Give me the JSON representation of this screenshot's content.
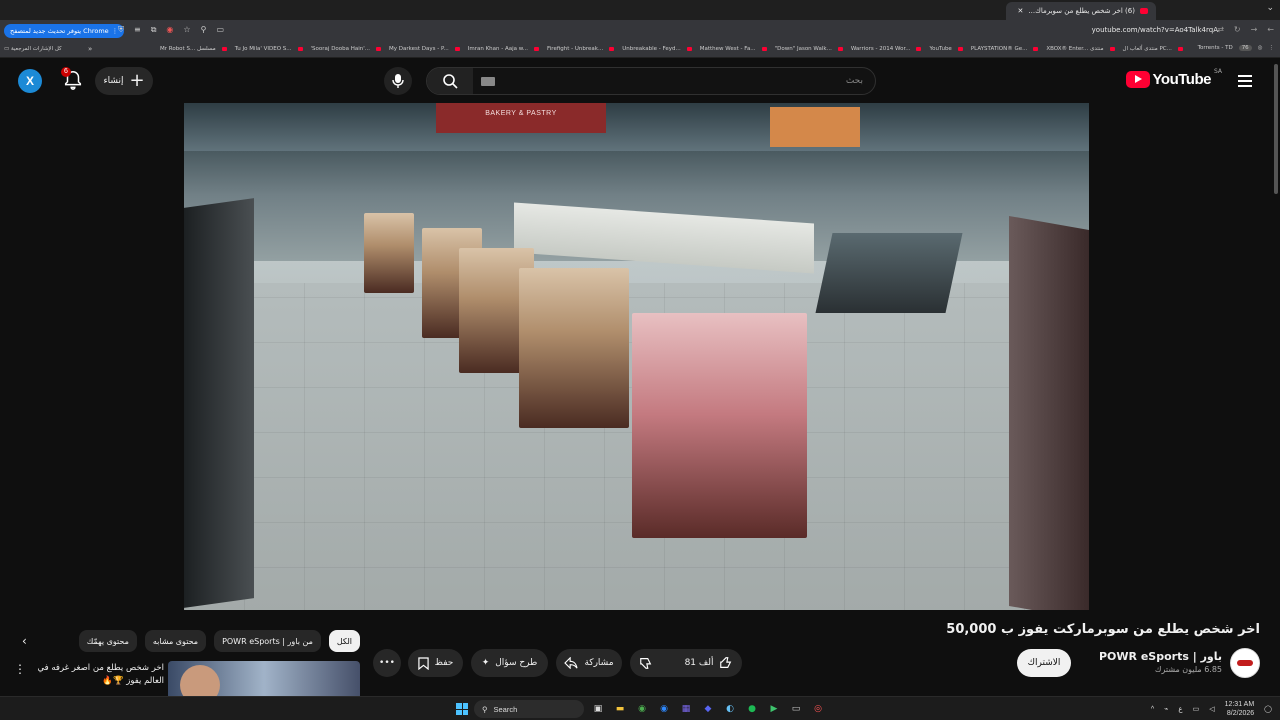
{
  "browser": {
    "tab_title": "(6) اخر شخص يطلع من سوبرماك...",
    "update_label": "يتوفر تحديث جديد لمتصفح Chrome",
    "url": "youtube.com/watch?v=Ao4Talk4rqA",
    "bookmarks_all": "كل الإشارات المرجعية",
    "bookmarks": [
      "Mr Robot S... مسلسل",
      "Tu Jo Mila' VIDEO S...",
      "'Sooraj Dooba Hain'...",
      "My Darkest Days - P...",
      "Imran Khan - Aaja w...",
      "Firefight - Unbreak...",
      "Unbreakable - Feyd...",
      "Matthew West - Fa...",
      "\"Down\" Jason Walk...",
      "Warriors - 2014 Wor...",
      "YouTube",
      "PLAYSTATION® Ge...",
      "XBOX® Enter... منتدى",
      "منتدى ألعاب ال PC..."
    ],
    "bookmarks_tail": "Torrents - TD",
    "bookmarks_tail_badge": "76"
  },
  "masthead": {
    "avatar_letter": "X",
    "notif_count": "6",
    "create_label": "إنشاء",
    "search_placeholder": "بحث",
    "logo_text": "YouTube",
    "country": "SA"
  },
  "video": {
    "sign_text": "BAKERY & PASTRY"
  },
  "watch": {
    "title": "اخر شخص يطلع من سوبرماركت يفوز ب 50,000",
    "channel_name": "باور | POWR eSports",
    "subscribers": "6.85 مليون مشترك",
    "subscribe_label": "الاشتراك",
    "likes": "81 ألف",
    "share_label": "مشاركة",
    "ask_label": "طرح سؤال",
    "save_label": "حفظ",
    "more_label": "•••"
  },
  "chips": [
    {
      "label": "الكل",
      "active": true
    },
    {
      "label": "من باور | POWR eSports",
      "active": false
    },
    {
      "label": "محتوى مشابه",
      "active": false
    },
    {
      "label": "محتوى يهمّك",
      "active": false
    }
  ],
  "recommendation": {
    "title": "اخر شخص يطلع من اصغر غرفه في العالم يفوز 🏆🔥"
  },
  "taskbar": {
    "search_label": "Search",
    "time": "12:31 AM",
    "date": "8/2/2026",
    "lang": "ع"
  }
}
